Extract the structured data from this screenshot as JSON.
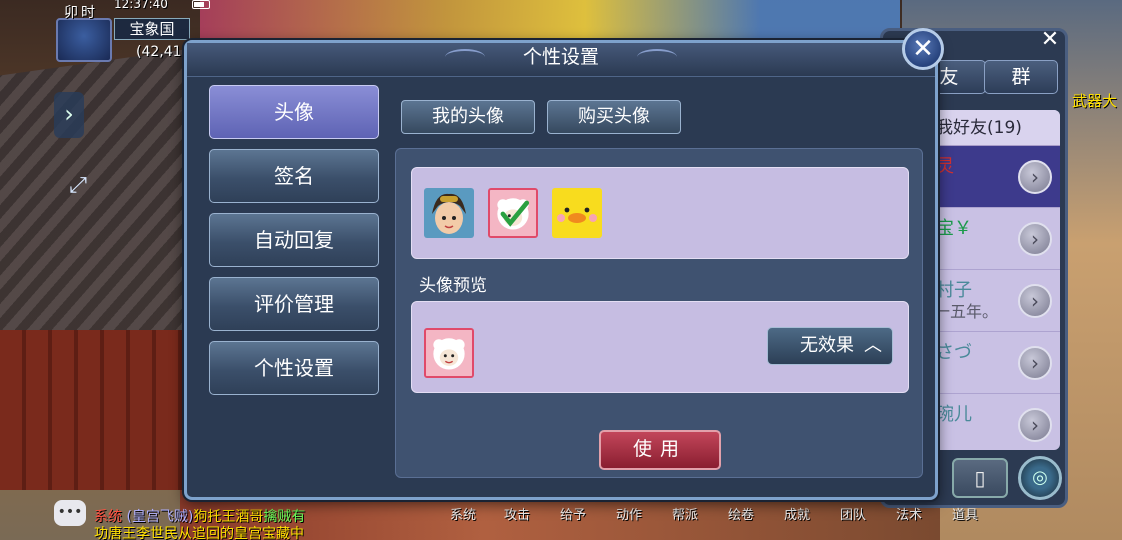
{
  "hud": {
    "shichen": "卯时",
    "clock": "12:37:40",
    "place": "宝象国",
    "coords": "(42,41"
  },
  "dialog": {
    "title": "个性设置",
    "close_label": "✕",
    "nav": [
      "头像",
      "签名",
      "自动回复",
      "评价管理",
      "个性设置"
    ],
    "tabs": [
      "我的头像",
      "购买头像"
    ],
    "preview_label": "头像预览",
    "effect_label": "无效果",
    "use_label": "使用"
  },
  "friends": {
    "tab_friend": "友",
    "tab_group": "群",
    "header": "我好友(19)",
    "rows": [
      {
        "name": "灵",
        "sub": ""
      },
      {
        "name": "宝￥",
        "sub": ""
      },
      {
        "name": "村子",
        "sub": "一五年。"
      },
      {
        "name": "さづ",
        "sub": ""
      },
      {
        "name": "琬儿",
        "sub": ""
      }
    ],
    "close_label": "✕",
    "weapon_label": "武器大"
  },
  "chat": {
    "line1_sys": "系统",
    "line1_tag": "(皇宫飞贼)",
    "line1_name": "狗托王酒哥",
    "line1_act": "擒贼有",
    "line2": "功唐王李世民从追回的皇宫宝藏中"
  },
  "bottom_menu": [
    "系统",
    "攻击",
    "给予",
    "动作",
    "帮派",
    "绘卷",
    "成就",
    "团队",
    "法术",
    "道具"
  ],
  "colors": {
    "accent_purple": "#6a6fc4",
    "use_red": "#a82a3e",
    "panel_lilac": "#c6bde2"
  }
}
